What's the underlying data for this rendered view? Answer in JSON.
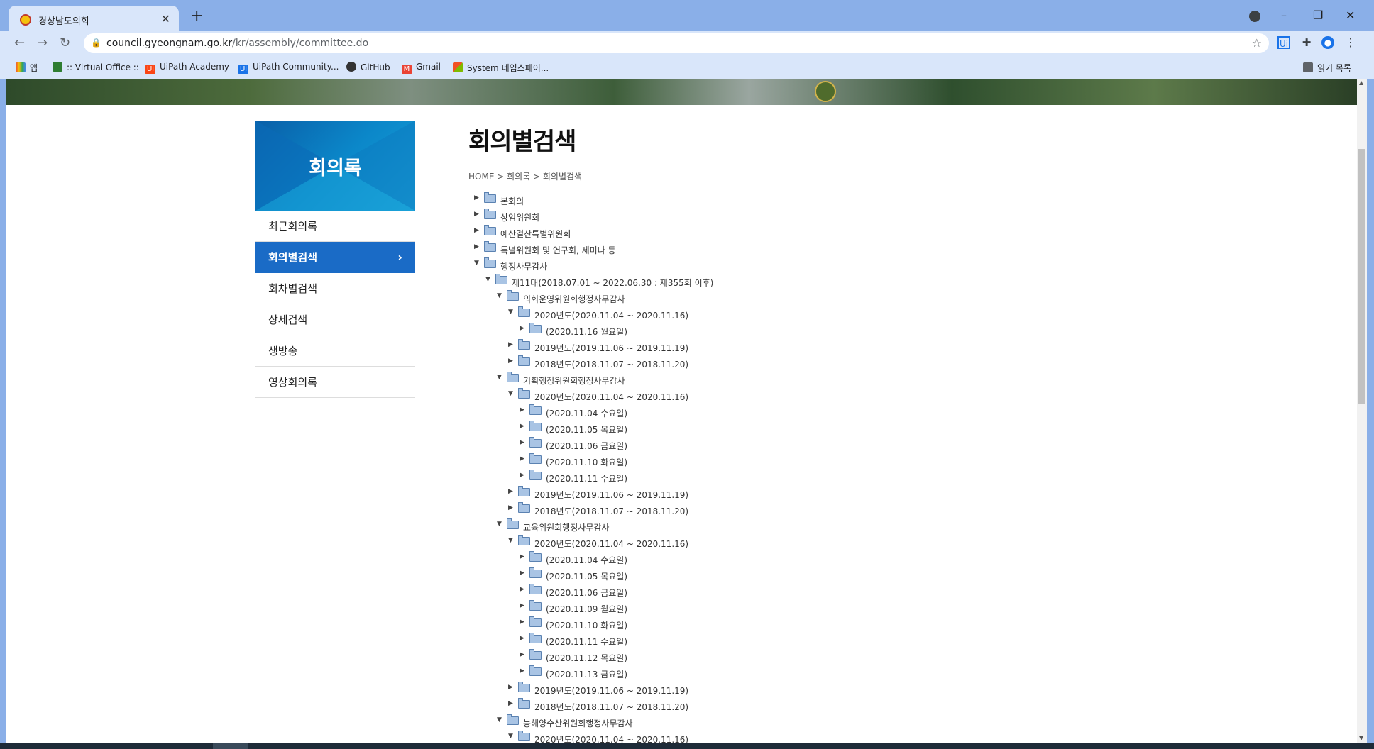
{
  "browser": {
    "tab_title": "경상남도의회",
    "url_host": "council.gyeongnam.go.kr",
    "url_path": "/kr/assembly/committee.do",
    "bookmarks": [
      "앱",
      ":: Virtual Office ::",
      "UiPath Academy",
      "UiPath Community...",
      "GitHub",
      "Gmail",
      "System 네임스페이...",
      "읽기 목록"
    ],
    "ext_label": "Ui"
  },
  "sidebar": {
    "title": "회의록",
    "items": [
      "최근회의록",
      "회의별검색",
      "회차별검색",
      "상세검색",
      "생방송",
      "영상회의록"
    ],
    "active_index": 1
  },
  "main": {
    "title": "회의별검색",
    "breadcrumb": "HOME > 회의록 > 회의별검색"
  },
  "tree": [
    {
      "label": "본회의",
      "depth": 0,
      "expanded": false
    },
    {
      "label": "상임위원회",
      "depth": 0,
      "expanded": false
    },
    {
      "label": "예산결산특별위원회",
      "depth": 0,
      "expanded": false
    },
    {
      "label": "특별위원회 및 연구회, 세미나 등",
      "depth": 0,
      "expanded": false
    },
    {
      "label": "행정사무감사",
      "depth": 0,
      "expanded": true
    },
    {
      "label": "제11대(2018.07.01 ~ 2022.06.30 : 제355회 이후)",
      "depth": 1,
      "expanded": true
    },
    {
      "label": "의회운영위원회행정사무감사",
      "depth": 2,
      "expanded": true
    },
    {
      "label": "2020년도(2020.11.04 ~ 2020.11.16)",
      "depth": 3,
      "expanded": true
    },
    {
      "label": "(2020.11.16 월요일)",
      "depth": 4,
      "expanded": false
    },
    {
      "label": "2019년도(2019.11.06 ~ 2019.11.19)",
      "depth": 3,
      "expanded": false
    },
    {
      "label": "2018년도(2018.11.07 ~ 2018.11.20)",
      "depth": 3,
      "expanded": false
    },
    {
      "label": "기획행정위원회행정사무감사",
      "depth": 2,
      "expanded": true
    },
    {
      "label": "2020년도(2020.11.04 ~ 2020.11.16)",
      "depth": 3,
      "expanded": true
    },
    {
      "label": "(2020.11.04 수요일)",
      "depth": 4,
      "expanded": false
    },
    {
      "label": "(2020.11.05 목요일)",
      "depth": 4,
      "expanded": false
    },
    {
      "label": "(2020.11.06 금요일)",
      "depth": 4,
      "expanded": false
    },
    {
      "label": "(2020.11.10 화요일)",
      "depth": 4,
      "expanded": false
    },
    {
      "label": "(2020.11.11 수요일)",
      "depth": 4,
      "expanded": false
    },
    {
      "label": "2019년도(2019.11.06 ~ 2019.11.19)",
      "depth": 3,
      "expanded": false
    },
    {
      "label": "2018년도(2018.11.07 ~ 2018.11.20)",
      "depth": 3,
      "expanded": false
    },
    {
      "label": "교육위원회행정사무감사",
      "depth": 2,
      "expanded": true
    },
    {
      "label": "2020년도(2020.11.04 ~ 2020.11.16)",
      "depth": 3,
      "expanded": true
    },
    {
      "label": "(2020.11.04 수요일)",
      "depth": 4,
      "expanded": false
    },
    {
      "label": "(2020.11.05 목요일)",
      "depth": 4,
      "expanded": false
    },
    {
      "label": "(2020.11.06 금요일)",
      "depth": 4,
      "expanded": false
    },
    {
      "label": "(2020.11.09 월요일)",
      "depth": 4,
      "expanded": false
    },
    {
      "label": "(2020.11.10 화요일)",
      "depth": 4,
      "expanded": false
    },
    {
      "label": "(2020.11.11 수요일)",
      "depth": 4,
      "expanded": false
    },
    {
      "label": "(2020.11.12 목요일)",
      "depth": 4,
      "expanded": false
    },
    {
      "label": "(2020.11.13 금요일)",
      "depth": 4,
      "expanded": false
    },
    {
      "label": "2019년도(2019.11.06 ~ 2019.11.19)",
      "depth": 3,
      "expanded": false
    },
    {
      "label": "2018년도(2018.11.07 ~ 2018.11.20)",
      "depth": 3,
      "expanded": false
    },
    {
      "label": "농해양수산위원회행정사무감사",
      "depth": 2,
      "expanded": true
    },
    {
      "label": "2020년도(2020.11.04 ~ 2020.11.16)",
      "depth": 3,
      "expanded": true
    }
  ],
  "icons": {
    "collapsed": "tree-collapsed-arrow-icon",
    "expanded": "tree-expanded-arrow-icon",
    "folder": "folder-icon"
  },
  "colors": {
    "chrome": "#8aafe8",
    "sidebar_active": "#1a6bc6",
    "sidebar_header": "#0b87c9"
  }
}
